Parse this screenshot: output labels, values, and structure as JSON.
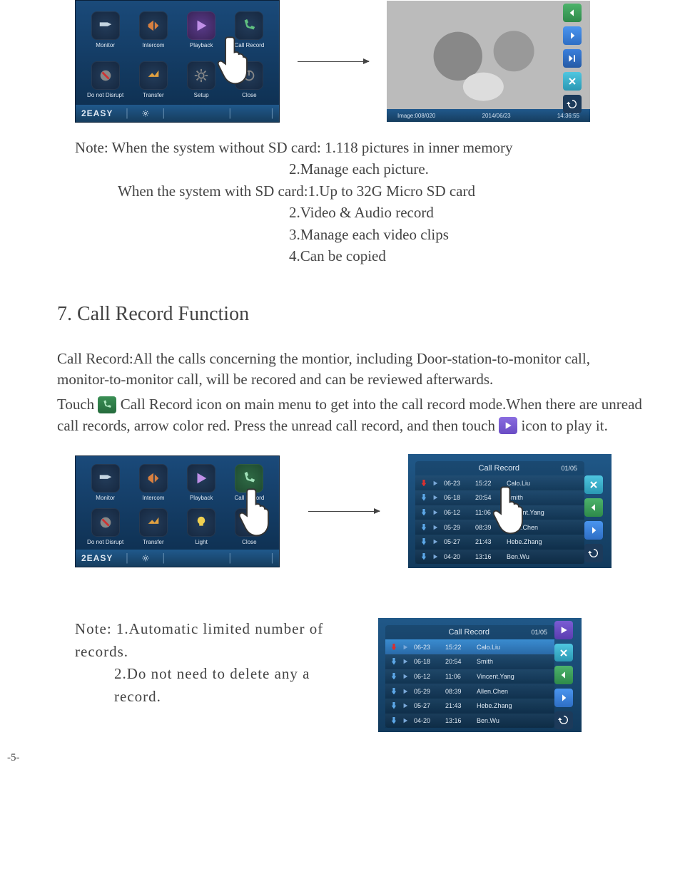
{
  "menu1": {
    "items": [
      "Monitor",
      "Intercom",
      "Playback",
      "Call Record",
      "Do not Disrupt",
      "Transfer",
      "Setup",
      "Close"
    ],
    "logo": "2EASY"
  },
  "photo_status": {
    "image": "Image:008/020",
    "date": "2014/06/23",
    "time": "14:36:55"
  },
  "note1": {
    "l1": "Note: When the system without SD card: 1.118 pictures in inner memory",
    "l2": "2.Manage each picture.",
    "l3": "When the system with SD card:1.Up to 32G Micro SD card",
    "l4": "2.Video & Audio record",
    "l5": "3.Manage each video clips",
    "l6": "4.Can be copied"
  },
  "section": {
    "heading": "7. Call Record Function",
    "p1": "Call Record:All the calls concerning the montior, including Door-station-to-monitor call, monitor-to-monitor call, will be recored and can be reviewed afterwards.",
    "p2a": "Touch ",
    "p2b": " Call Record icon on main menu to get into the call record mode.When there are unread call records, arrow color red. Press the unread call record, and then touch ",
    "p2c": " icon to play it."
  },
  "menu2": {
    "items": [
      "Monitor",
      "Intercom",
      "Playback",
      "Call Record",
      "Do not Disrupt",
      "Transfer",
      "Light",
      "Close"
    ],
    "logo": "2EASY"
  },
  "call_record": {
    "title": "Call Record",
    "page": "01/05",
    "rows": [
      {
        "date": "06-23",
        "time": "15:22",
        "name": "Calo.Liu",
        "unread": "red"
      },
      {
        "date": "06-18",
        "time": "20:54",
        "name": "Smith",
        "unread": "blue"
      },
      {
        "date": "06-12",
        "time": "11:06",
        "name": "Vincent.Yang",
        "unread": "blue"
      },
      {
        "date": "05-29",
        "time": "08:39",
        "name": "Allen.Chen",
        "unread": "blue"
      },
      {
        "date": "05-27",
        "time": "21:43",
        "name": "Hebe.Zhang",
        "unread": "blue"
      },
      {
        "date": "04-20",
        "time": "13:16",
        "name": "Ben.Wu",
        "unread": "blue"
      }
    ]
  },
  "note2": {
    "l1": "Note: 1.Automatic limited number of records.",
    "l2": "2.Do not need to delete any a record."
  },
  "page_num": "-5-"
}
